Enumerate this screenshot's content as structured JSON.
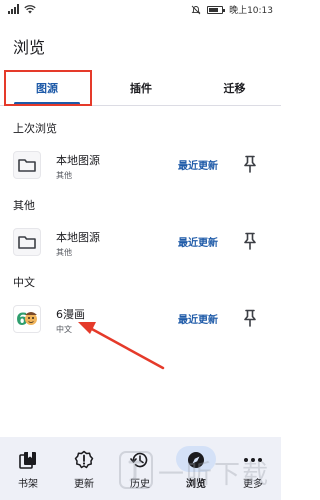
{
  "status_bar": {
    "time": "晚上10:13"
  },
  "header": {
    "title": "浏览"
  },
  "tabs": [
    {
      "label": "图源",
      "selected": true
    },
    {
      "label": "插件",
      "selected": false
    },
    {
      "label": "迁移",
      "selected": false
    }
  ],
  "sections": [
    {
      "title": "上次浏览",
      "source": {
        "name": "本地图源",
        "lang": "其他",
        "icon": "folder-icon",
        "action": "最近更新"
      }
    },
    {
      "title": "其他",
      "source": {
        "name": "本地图源",
        "lang": "其他",
        "icon": "folder-icon",
        "action": "最近更新"
      }
    },
    {
      "title": "中文",
      "source": {
        "name": "6漫画",
        "lang": "中文",
        "icon": "6manhua-logo",
        "action": "最近更新"
      }
    }
  ],
  "bottom_nav": [
    {
      "label": "书架",
      "icon": "library-icon",
      "active": false
    },
    {
      "label": "更新",
      "icon": "updates-icon",
      "active": false
    },
    {
      "label": "历史",
      "icon": "history-icon",
      "active": false
    },
    {
      "label": "浏览",
      "icon": "compass-icon",
      "active": true
    },
    {
      "label": "更多",
      "icon": "more-icon",
      "active": false
    }
  ],
  "watermark": {
    "text": "一听下载"
  },
  "colors": {
    "accent": "#1e5aa8",
    "annotation": "#e53a2a",
    "nav_bg": "#eef0f7",
    "nav_active": "#d4e1f7"
  }
}
